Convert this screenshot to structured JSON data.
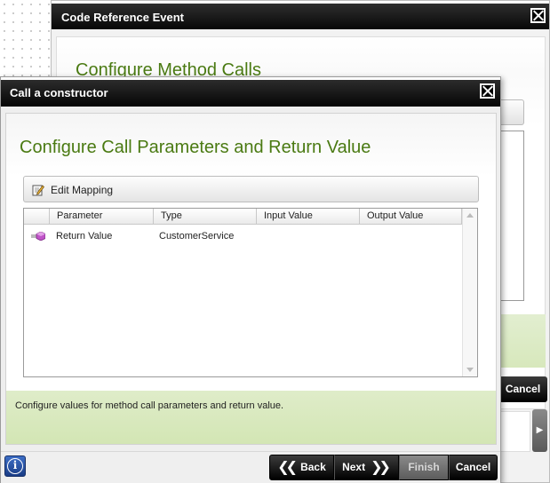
{
  "background_dialog": {
    "title": "Code Reference Event",
    "heading": "Configure Method Calls",
    "cancel_label": "Cancel"
  },
  "dialog": {
    "title": "Call a constructor",
    "heading": "Configure Call Parameters and Return Value",
    "toolbar": {
      "edit_mapping_label": "Edit Mapping",
      "edit_mapping_icon": "edit-pencil-icon"
    },
    "grid": {
      "columns": [
        "Parameter",
        "Type",
        "Input Value",
        "Output Value"
      ],
      "rows": [
        {
          "icon": "return-value-icon",
          "parameter": "Return Value",
          "type": "CustomerService",
          "input_value": "",
          "output_value": ""
        }
      ]
    },
    "info_text": "Configure values for method call parameters and return value."
  },
  "footer": {
    "info_icon": "info-icon",
    "back_label": "Back",
    "next_label": "Next",
    "finish_label": "Finish",
    "cancel_label": "Cancel"
  },
  "colors": {
    "heading_green": "#4a7a12",
    "titlebar": "#000000",
    "info_panel": "#d9e9c0",
    "info_button": "#2a54a8",
    "finish_disabled": "#6e6e6e"
  }
}
